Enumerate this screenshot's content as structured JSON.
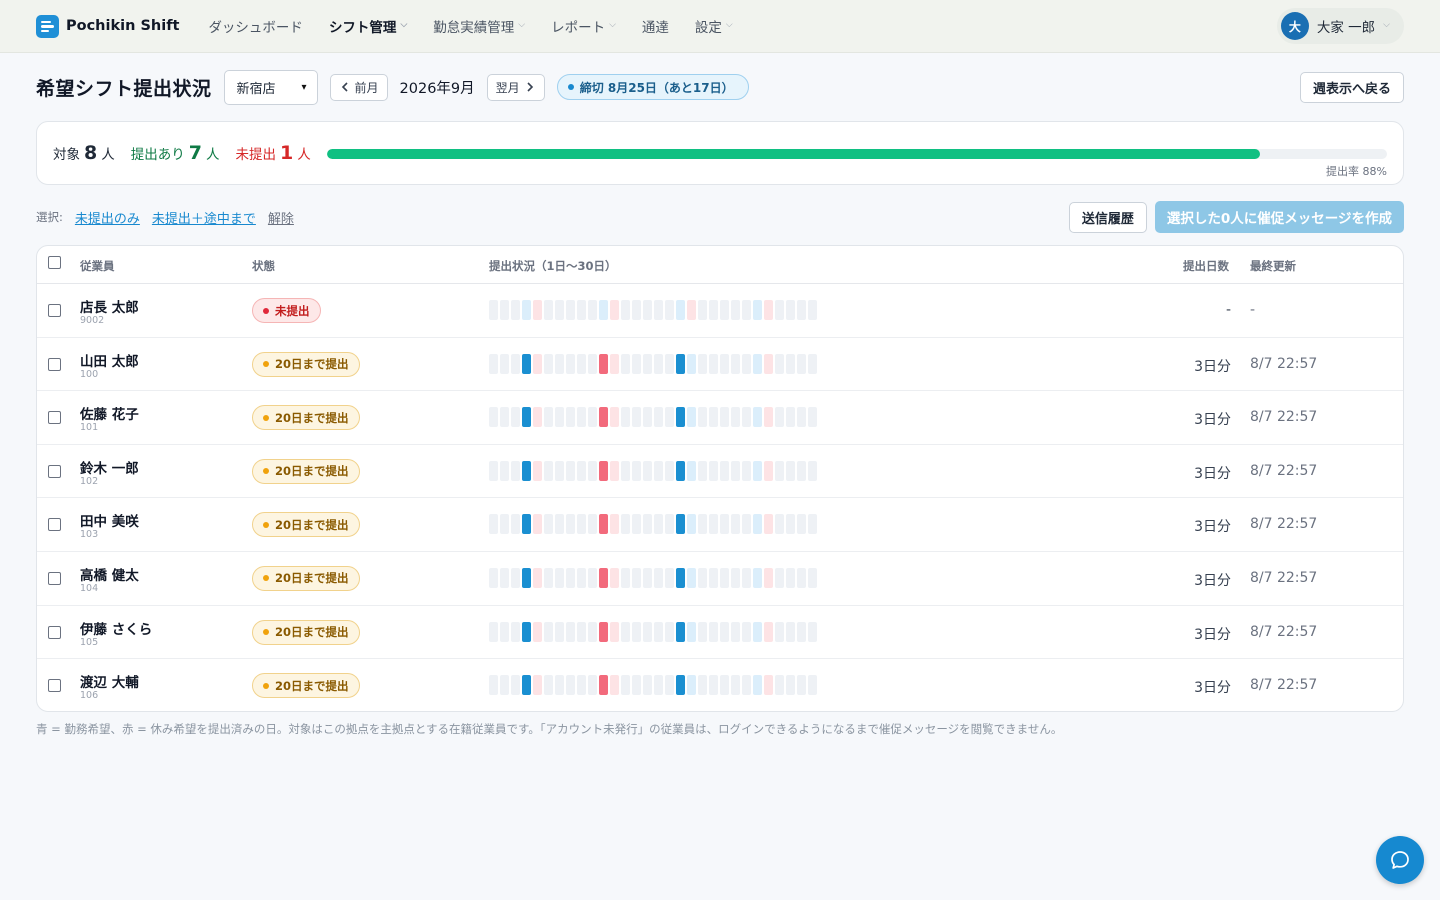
{
  "brand": {
    "name": "Pochikin Shift"
  },
  "nav": [
    {
      "label": "ダッシュボード",
      "active": false,
      "dropdown": false
    },
    {
      "label": "シフト管理",
      "active": true,
      "dropdown": true
    },
    {
      "label": "勤怠実績管理",
      "active": false,
      "dropdown": true
    },
    {
      "label": "レポート",
      "active": false,
      "dropdown": true
    },
    {
      "label": "通達",
      "active": false,
      "dropdown": false
    },
    {
      "label": "設定",
      "active": false,
      "dropdown": true
    }
  ],
  "user": {
    "avatar_initial": "大",
    "name": "大家 一郎"
  },
  "header": {
    "title": "希望シフト提出状況",
    "store": "新宿店",
    "prev_label": "前月",
    "month": "2026年9月",
    "next_label": "翌月",
    "deadline": "締切 8月25日（あと17日）",
    "back_label": "週表示へ戻る"
  },
  "summary": {
    "total_label": "対象",
    "total": "8",
    "total_unit": "人",
    "submitted_label": "提出あり",
    "submitted": "7",
    "submitted_unit": "人",
    "unsubmitted_label": "未提出",
    "unsubmitted": "1",
    "unsubmitted_unit": "人",
    "rate": 0.88,
    "rate_label": "提出率 88%"
  },
  "selection": {
    "label": "選択:",
    "only_unsubmitted": "未提出のみ",
    "unsubmitted_partial": "未提出＋途中まで",
    "clear": "解除",
    "history_label": "送信履歴",
    "remind_label": "選択した0人に催促メッセージを作成"
  },
  "table": {
    "headers": {
      "employee": "従業員",
      "status": "状態",
      "grid": "提出状況（1日〜30日）",
      "days": "提出日数",
      "updated": "最終更新"
    },
    "rows": [
      {
        "name": "店長 太郎",
        "id": "9002",
        "status": "未提出",
        "status_type": "red",
        "days": "-",
        "updated": "-",
        "cells": "nnnlrnnnnnlrnnnnnlrnnnnnlrnnnn"
      },
      {
        "name": "山田 太郎",
        "id": "100",
        "status": "20日まで提出",
        "status_type": "amber",
        "days": "3日分",
        "updated": "8/7 22:57",
        "cells": "nnnbrnnnnnrrnnnnnbbnnnnnlrnnnn"
      },
      {
        "name": "佐藤 花子",
        "id": "101",
        "status": "20日まで提出",
        "status_type": "amber",
        "days": "3日分",
        "updated": "8/7 22:57",
        "cells": "nnnbrnnnnnrrnnnnnbbnnnnnlrnnnn"
      },
      {
        "name": "鈴木 一郎",
        "id": "102",
        "status": "20日まで提出",
        "status_type": "amber",
        "days": "3日分",
        "updated": "8/7 22:57",
        "cells": "nnnbrnnnnnrrnnnnnbbnnnnnlrnnnn"
      },
      {
        "name": "田中 美咲",
        "id": "103",
        "status": "20日まで提出",
        "status_type": "amber",
        "days": "3日分",
        "updated": "8/7 22:57",
        "cells": "nnnbrnnnnnrrnnnnnbbnnnnnlrnnnn"
      },
      {
        "name": "高橋 健太",
        "id": "104",
        "status": "20日まで提出",
        "status_type": "amber",
        "days": "3日分",
        "updated": "8/7 22:57",
        "cells": "nnnbrnnnnnrrnnnnnbbnnnnnlrnnnn"
      },
      {
        "name": "伊藤 さくら",
        "id": "105",
        "status": "20日まで提出",
        "status_type": "amber",
        "days": "3日分",
        "updated": "8/7 22:57",
        "cells": "nnnbrnnnnnrrnnnnnbbnnnnnlrnnnn"
      },
      {
        "name": "渡辺 大輔",
        "id": "106",
        "status": "20日まで提出",
        "status_type": "amber",
        "days": "3日分",
        "updated": "8/7 22:57",
        "cells": "nnnbrnnnnnrrnnnnnbbnnnnnlrnnnn"
      }
    ]
  },
  "footnote": "青 = 勤務希望、赤 = 休み希望を提出済みの日。対象はこの拠点を主拠点とする在籍従業員です。「アカウント未発行」の従業員は、ログインできるようになるまで催促メッセージを閲覧できません。",
  "icons": {
    "chat": "chat-bubble-icon",
    "prev": "chevron-left-icon",
    "next": "chevron-right-icon"
  },
  "colors": {
    "accent": "#1889cf",
    "progress": "#10c082",
    "unsubmitted": "#d62828",
    "submitted": "#0f7a45"
  }
}
